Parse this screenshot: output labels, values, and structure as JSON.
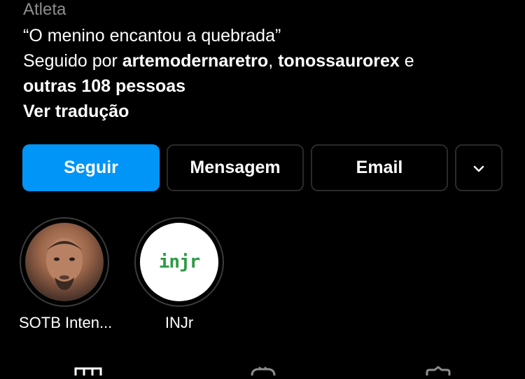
{
  "profile": {
    "category": "Atleta",
    "bio_quote": "“O menino encantou a quebrada”",
    "followed_by_prefix": "Seguido por",
    "followed_user_1": "artemodernaretro",
    "separator": ",",
    "followed_user_2": "tonossaurorex",
    "conjunction": "e",
    "followed_others": "outras 108 pessoas",
    "translate_label": "Ver tradução"
  },
  "actions": {
    "follow_label": "Seguir",
    "message_label": "Mensagem",
    "email_label": "Email",
    "more_icon": "chevron-down-icon"
  },
  "highlights": [
    {
      "label": "SOTB Inten...",
      "icon": "person-photo"
    },
    {
      "label": "INJr",
      "icon": "injr-logo",
      "logo_text": "injr"
    }
  ],
  "tabs": [
    {
      "icon": "grid-icon"
    },
    {
      "icon": "reels-icon"
    },
    {
      "icon": "tagged-icon"
    }
  ],
  "colors": {
    "accent": "#0095f6",
    "background": "#000000",
    "secondary_text": "#8e8e8e",
    "logo_green": "#2e9b45",
    "logo_yellow": "#f2c318"
  }
}
